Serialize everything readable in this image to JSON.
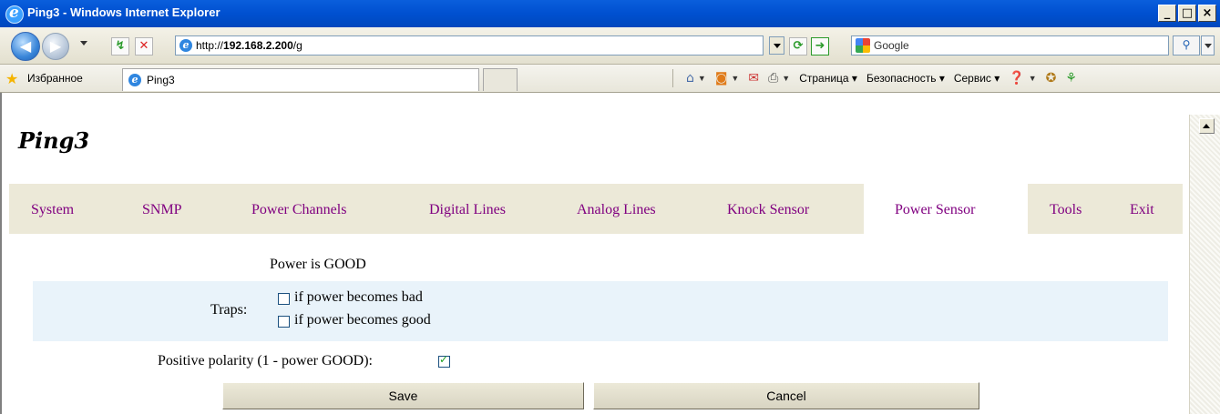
{
  "window": {
    "title": "Ping3 - Windows Internet Explorer",
    "minimize": "_",
    "maximize": "□",
    "close": "×"
  },
  "address": {
    "url_prefix": "http://",
    "url_host": "192.168.2.200",
    "url_path": "/g",
    "search_label": "Google"
  },
  "favorites": {
    "label": "Избранное",
    "tab_title": "Ping3"
  },
  "commands": {
    "page": "Страница",
    "security": "Безопасность",
    "service": "Сервис"
  },
  "app": {
    "title": "Ping3"
  },
  "menu": {
    "items": [
      "System",
      "SNMP",
      "Power Channels",
      "Digital Lines",
      "Analog Lines",
      "Knock Sensor",
      "Power Sensor",
      "Tools",
      "Exit"
    ],
    "active": "Power Sensor"
  },
  "form": {
    "status": "Power is GOOD",
    "traps_label": "Traps:",
    "trap_bad": "if power becomes bad",
    "trap_good": "if power becomes good",
    "trap_bad_checked": false,
    "trap_good_checked": false,
    "polarity_label": "Positive polarity (1 - power GOOD):",
    "polarity_checked": true,
    "save": "Save",
    "cancel": "Cancel"
  },
  "colors": {
    "menu_link": "#800080",
    "title_bar": "#0050d0",
    "traps_band": "#e9f3fa"
  }
}
